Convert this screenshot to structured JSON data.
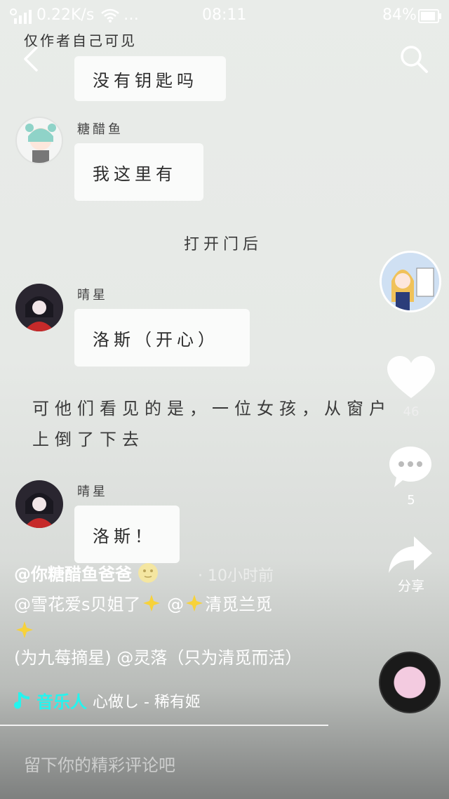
{
  "status_bar": {
    "speed": "0.22K/s",
    "dots": "…",
    "time": "08:11",
    "battery": "84%"
  },
  "video": {
    "top_hint": "仅作者自己可见",
    "bubble_top": "没有钥匙吗",
    "user1_name": "糖醋鱼",
    "user1_msg": "我这里有",
    "scene_text": "打开门后",
    "user2_name": "晴星",
    "user2_msg": "洛斯（开心）",
    "narration": "可他们看见的是，一位女孩，从窗户上倒了下去",
    "user2_name_b": "晴星",
    "user2_msg_b": "洛斯！"
  },
  "actions": {
    "like_count": "46",
    "comment_count": "5",
    "share_label": "分享"
  },
  "caption": {
    "author": "@你糖醋鱼爸爸",
    "time": "· 10小时前",
    "line_a": "@雪花爱s贝姐了",
    "line_b": " @",
    "line_c": "清觅兰觅",
    "line_d": "(为九莓摘星) @灵落（只为清觅而活）"
  },
  "music": {
    "tag": "音乐人",
    "song": "心做し - 稀有姬"
  },
  "comment_placeholder": "留下你的精彩评论吧"
}
